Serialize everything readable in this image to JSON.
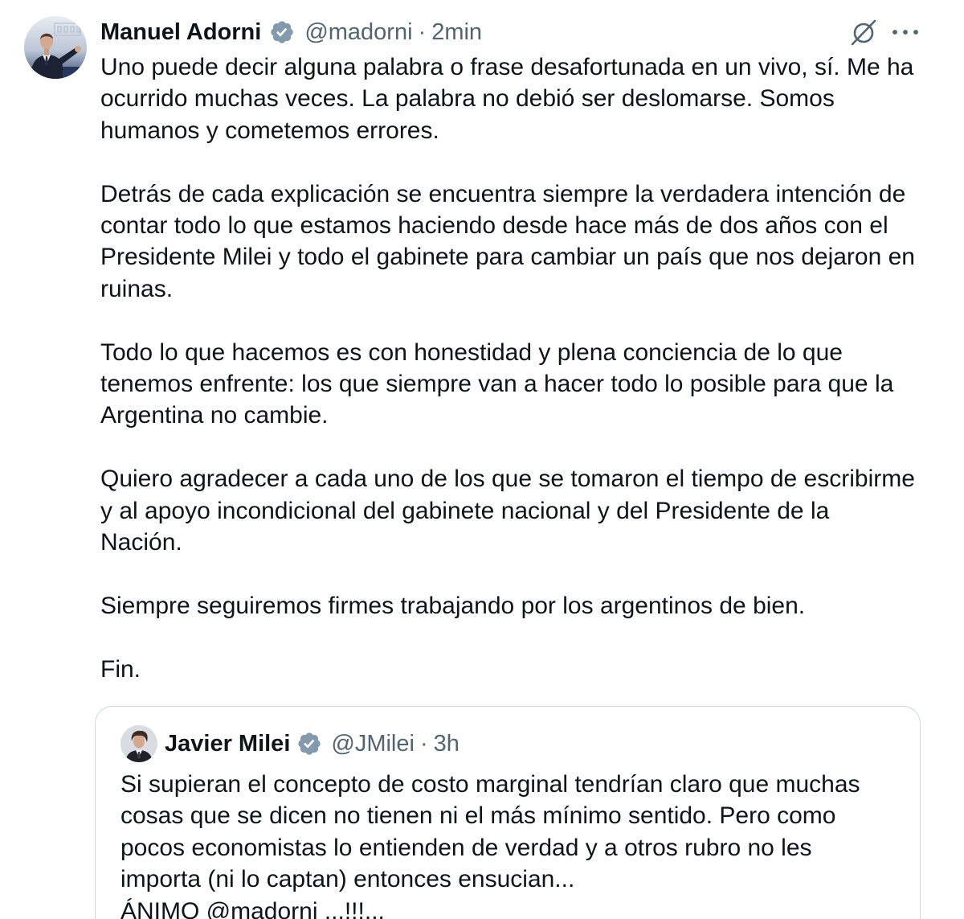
{
  "tweet": {
    "author": {
      "name": "Manuel Adorni",
      "handle": "@madorni",
      "separator": "·",
      "time": "2min"
    },
    "paragraphs": [
      [
        "Uno puede decir alguna palabra o frase desafortunada en un vivo, sí. Me ha",
        "ocurrido muchas veces. La palabra no debió ser deslomarse. Somos",
        "humanos y cometemos errores."
      ],
      [
        "Detrás de cada explicación se encuentra siempre la verdadera intención de",
        "contar todo lo que estamos haciendo desde hace más de dos años con el",
        "Presidente Milei y todo el gabinete para cambiar un país que nos dejaron en",
        "ruinas."
      ],
      [
        "Todo lo que hacemos es con honestidad y plena conciencia de lo que",
        "tenemos enfrente: los que siempre van a hacer todo lo posible para que la",
        "Argentina no cambie."
      ],
      [
        "Quiero agradecer a cada uno de los que se tomaron el tiempo de escribirme",
        "y al apoyo incondicional del gabinete nacional y del Presidente de la",
        "Nación."
      ],
      [
        "Siempre seguiremos firmes trabajando por los argentinos de bien."
      ],
      [
        "Fin."
      ]
    ],
    "quoted": {
      "author": {
        "name": "Javier Milei",
        "handle": "@JMilei",
        "separator": "·",
        "time": "3h"
      },
      "lines": [
        "Si supieran el concepto de costo marginal tendrían claro que muchas",
        "cosas que se dicen no tienen ni el más mínimo sentido. Pero como",
        "pocos economistas lo entienden de verdad y a otros rubro no les",
        "importa (ni lo captan) entonces ensucian...",
        "ÁNIMO @madorni ...!!!..."
      ]
    }
  },
  "icons": {
    "verified": "verified-badge-icon",
    "grok": "grok-icon",
    "more": "more-icon"
  },
  "colors": {
    "text": "#0f1419",
    "secondary": "#536471",
    "verified": "#829aab",
    "border": "#cfd9de",
    "background": "#ffffff"
  }
}
